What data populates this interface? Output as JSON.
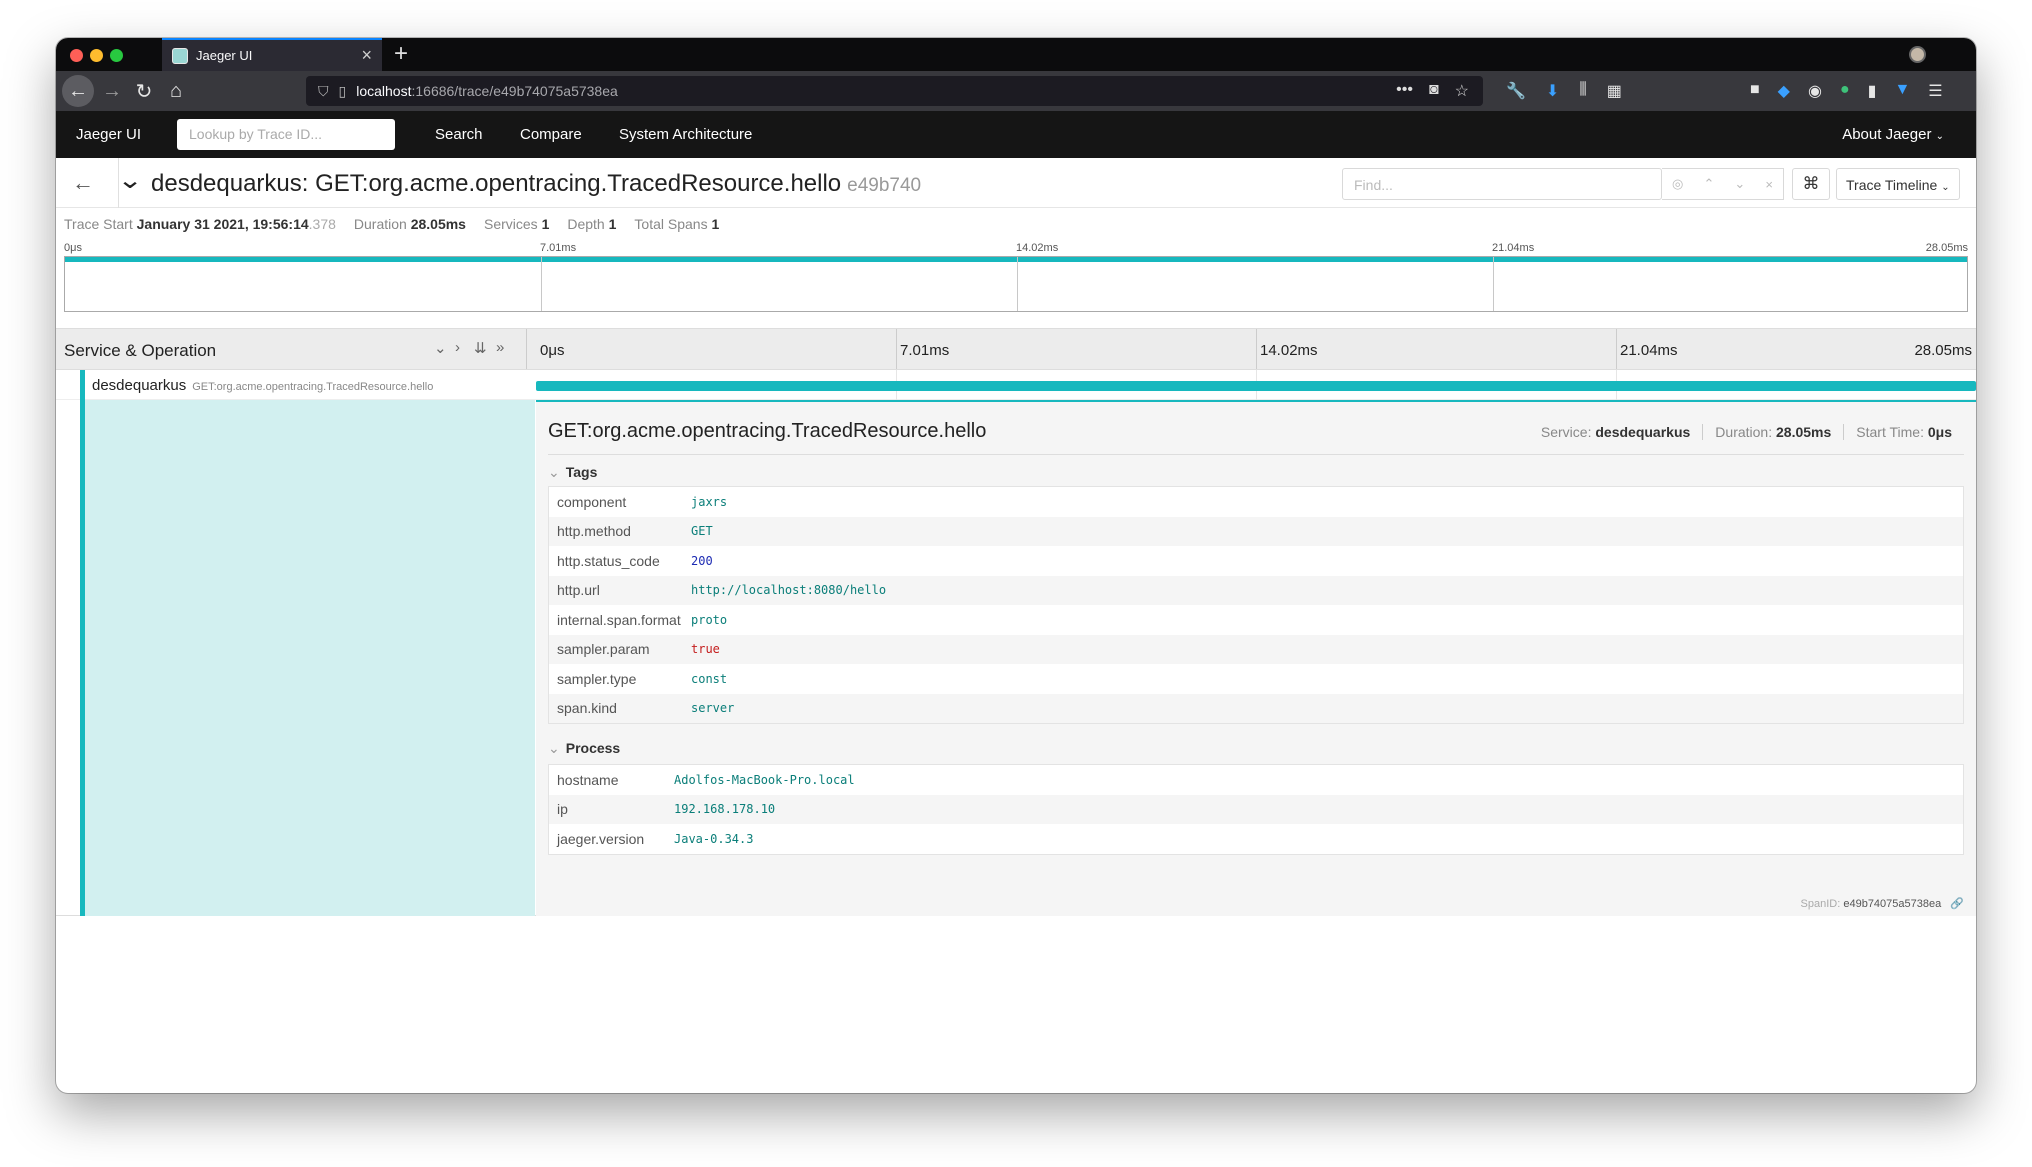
{
  "browser": {
    "tab_title": "Jaeger UI",
    "url_host": "localhost",
    "url_path": ":16686/trace/e49b74075a5738ea"
  },
  "jaeger_nav": {
    "brand": "Jaeger UI",
    "lookup_placeholder": "Lookup by Trace ID...",
    "links": [
      "Search",
      "Compare",
      "System Architecture"
    ],
    "about": "About Jaeger"
  },
  "trace": {
    "title": "desdequarkus: GET:org.acme.opentracing.TracedResource.hello",
    "trace_id_short": "e49b740",
    "find_placeholder": "Find...",
    "view_mode": "Trace Timeline",
    "summary": {
      "trace_start_label": "Trace Start",
      "trace_start_date": "January 31 2021, 19:56:14",
      "trace_start_ms": ".378",
      "duration_label": "Duration",
      "duration": "28.05ms",
      "services_label": "Services",
      "services": "1",
      "depth_label": "Depth",
      "depth": "1",
      "total_spans_label": "Total Spans",
      "total_spans": "1"
    },
    "minimap_ticks": [
      "0μs",
      "7.01ms",
      "14.02ms",
      "21.04ms",
      "28.05ms"
    ],
    "timeline_label": "Service & Operation",
    "timeline_ticks": [
      "0μs",
      "7.01ms",
      "14.02ms",
      "21.04ms",
      "28.05ms"
    ]
  },
  "span": {
    "service": "desdequarkus",
    "operation": "GET:org.acme.opentracing.TracedResource.hello",
    "detail_title": "GET:org.acme.opentracing.TracedResource.hello",
    "service_label": "Service:",
    "duration_label": "Duration:",
    "start_time_label": "Start Time:",
    "start_time": "0μs",
    "tags_label": "Tags",
    "tags": [
      {
        "key": "component",
        "value": "jaxrs",
        "color": "#0a7e79"
      },
      {
        "key": "http.method",
        "value": "GET",
        "color": "#0a7e79"
      },
      {
        "key": "http.status_code",
        "value": "200",
        "color": "#1d2bb3"
      },
      {
        "key": "http.url",
        "value": "http://localhost:8080/hello",
        "color": "#0a7e79"
      },
      {
        "key": "internal.span.format",
        "value": "proto",
        "color": "#0a7e79"
      },
      {
        "key": "sampler.param",
        "value": "true",
        "color": "#c41d1d"
      },
      {
        "key": "sampler.type",
        "value": "const",
        "color": "#0a7e79"
      },
      {
        "key": "span.kind",
        "value": "server",
        "color": "#0a7e79"
      }
    ],
    "process_label": "Process",
    "process": [
      {
        "key": "hostname",
        "value": "Adolfos-MacBook-Pro.local"
      },
      {
        "key": "ip",
        "value": "192.168.178.10"
      },
      {
        "key": "jaeger.version",
        "value": "Java-0.34.3"
      }
    ],
    "span_id_label": "SpanID:",
    "span_id": "e49b74075a5738ea"
  },
  "colors": {
    "accent": "#17b8be",
    "nav_bg": "#151515"
  }
}
